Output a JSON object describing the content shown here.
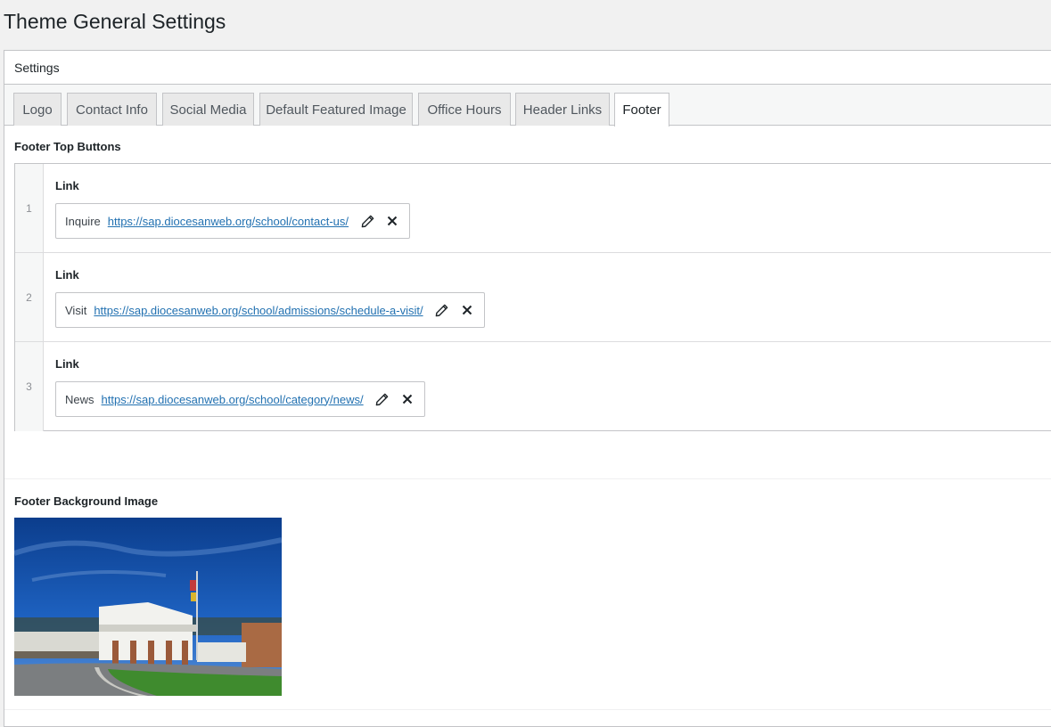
{
  "page": {
    "title": "Theme General Settings"
  },
  "panel": {
    "title": "Settings"
  },
  "tabs": [
    {
      "label": "Logo"
    },
    {
      "label": "Contact Info"
    },
    {
      "label": "Social Media"
    },
    {
      "label": "Default Featured Image"
    },
    {
      "label": "Office Hours"
    },
    {
      "label": "Header Links"
    },
    {
      "label": "Footer",
      "active": true
    }
  ],
  "footer_top_buttons": {
    "label": "Footer Top Buttons",
    "rows": [
      {
        "index": "1",
        "sub_label": "Link",
        "title": "Inquire",
        "url": "https://sap.diocesanweb.org/school/contact-us/"
      },
      {
        "index": "2",
        "sub_label": "Link",
        "title": "Visit",
        "url": "https://sap.diocesanweb.org/school/admissions/schedule-a-visit/"
      },
      {
        "index": "3",
        "sub_label": "Link",
        "title": "News",
        "url": "https://sap.diocesanweb.org/school/category/news/"
      }
    ]
  },
  "footer_background_image": {
    "label": "Footer Background Image"
  },
  "icons": {
    "edit": "pencil-icon",
    "remove": "close-icon"
  },
  "colors": {
    "link": "#2271b1",
    "border": "#c3c4c7",
    "page_bg": "#f1f1f1"
  }
}
